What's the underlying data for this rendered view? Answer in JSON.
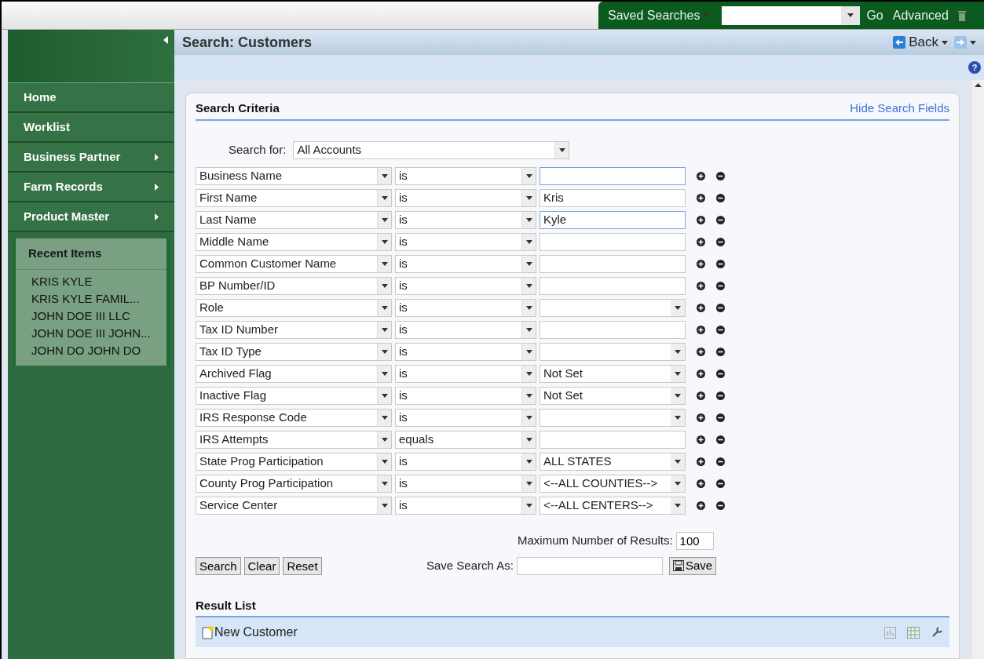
{
  "top_bar": {
    "saved_searches": "Saved Searches",
    "go": "Go",
    "advanced": "Advanced"
  },
  "page_title": "Search: Customers",
  "nav": {
    "back": "Back",
    "help": "?"
  },
  "sidebar": {
    "items": [
      {
        "label": "Home",
        "has_submenu": false
      },
      {
        "label": "Worklist",
        "has_submenu": false
      },
      {
        "label": "Business Partner",
        "has_submenu": true
      },
      {
        "label": "Farm Records",
        "has_submenu": true
      },
      {
        "label": "Product Master",
        "has_submenu": true
      }
    ],
    "recent_title": "Recent Items",
    "recent_items": [
      "KRIS KYLE",
      "KRIS KYLE FAMIL...",
      "JOHN DOE III LLC",
      "JOHN DOE III JOHN...",
      "JOHN DO JOHN DO"
    ]
  },
  "search_criteria": {
    "title": "Search Criteria",
    "hide_link": "Hide Search Fields",
    "search_for_label": "Search for:",
    "search_for_value": "All Accounts",
    "rows": [
      {
        "attribute": "Business Name",
        "operator": "is",
        "kind": "text",
        "value": "",
        "focused": true
      },
      {
        "attribute": "First Name",
        "operator": "is",
        "kind": "text",
        "value": "Kris",
        "focused": false
      },
      {
        "attribute": "Last Name",
        "operator": "is",
        "kind": "text",
        "value": "Kyle",
        "focused": true
      },
      {
        "attribute": "Middle Name",
        "operator": "is",
        "kind": "text",
        "value": "",
        "focused": false
      },
      {
        "attribute": "Common Customer Name",
        "operator": "is",
        "kind": "text",
        "value": "",
        "focused": false
      },
      {
        "attribute": "BP Number/ID",
        "operator": "is",
        "kind": "text",
        "value": "",
        "focused": false
      },
      {
        "attribute": "Role",
        "operator": "is",
        "kind": "select",
        "value": "",
        "focused": false
      },
      {
        "attribute": "Tax ID Number",
        "operator": "is",
        "kind": "text",
        "value": "",
        "focused": false
      },
      {
        "attribute": "Tax ID Type",
        "operator": "is",
        "kind": "select",
        "value": "",
        "focused": false
      },
      {
        "attribute": "Archived Flag",
        "operator": "is",
        "kind": "select",
        "value": "Not Set",
        "focused": false
      },
      {
        "attribute": "Inactive Flag",
        "operator": "is",
        "kind": "select",
        "value": "Not Set",
        "focused": false
      },
      {
        "attribute": "IRS Response Code",
        "operator": "is",
        "kind": "select",
        "value": "",
        "focused": false
      },
      {
        "attribute": "IRS Attempts",
        "operator": "equals",
        "kind": "text",
        "value": "",
        "focused": false
      },
      {
        "attribute": "State Prog Participation",
        "operator": "is",
        "kind": "select",
        "value": "ALL STATES",
        "focused": false
      },
      {
        "attribute": "County Prog Participation",
        "operator": "is",
        "kind": "select",
        "value": "<--ALL COUNTIES-->",
        "focused": false
      },
      {
        "attribute": "Service Center",
        "operator": "is",
        "kind": "select",
        "value": "<--ALL CENTERS-->",
        "focused": false
      }
    ],
    "max_results_label": "Maximum Number of Results:",
    "max_results": "100",
    "buttons": [
      "Search",
      "Clear",
      "Reset"
    ],
    "save_as_label": "Save Search As:",
    "save_button": "Save"
  },
  "result_list": {
    "title": "Result List",
    "new_button": "New Customer"
  }
}
